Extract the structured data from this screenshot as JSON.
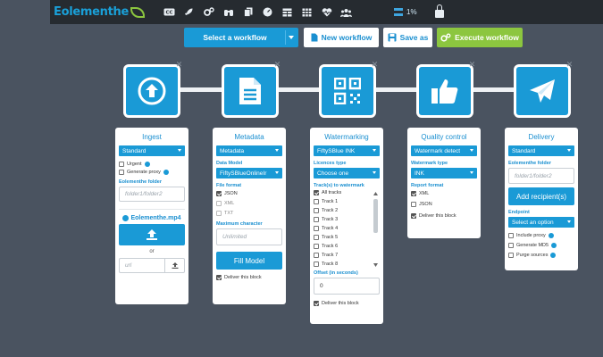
{
  "app": {
    "logo": "Eolementhe",
    "usage": "1%"
  },
  "nav_icons": [
    "cc-icon",
    "rocket-icon",
    "gears-icon",
    "binoculars-icon",
    "copy-icon",
    "gauge-icon",
    "table-icon",
    "grid-icon",
    "heartbeat-icon",
    "users-icon"
  ],
  "toolbar": {
    "select_workflow": "Select a workflow",
    "new_workflow": "New workflow",
    "save_as": "Save as",
    "execute": "Execute workflow"
  },
  "colors": {
    "accent": "#1a9ad6",
    "green": "#8cc63f",
    "background": "#4a5360",
    "topbar": "#262b30"
  },
  "blocks": {
    "ingest": {
      "title": "Ingest",
      "select": "Standard",
      "urgent": "Urgent",
      "generate_proxy": "Generate proxy",
      "folder_label": "Eolementhe folder",
      "folder_placeholder": "folder1/folder2",
      "file": "Eolementhe.mp4",
      "or": "or",
      "url_placeholder": "url"
    },
    "metadata": {
      "title": "Metadata",
      "select": "Metadata",
      "data_model_label": "Data Model",
      "data_model": "FiftySBlueOnlineIr",
      "file_format_label": "File format",
      "formats": [
        "JSON",
        "XML",
        "TXT"
      ],
      "max_char_label": "Maximum character",
      "max_char_placeholder": "Unlimited",
      "fill_model": "Fill Model",
      "deliver": "Deliver this block"
    },
    "watermarking": {
      "title": "Watermarking",
      "select": "FiftySBlue INK",
      "licences_label": "Licences type",
      "licences": "Choose one",
      "tracks_label": "Track(s) to watermark",
      "tracks": [
        "All tracks",
        "Track 1",
        "Track 2",
        "Track 3",
        "Track 4",
        "Track 5",
        "Track 6",
        "Track 7",
        "Track 8"
      ],
      "offset_label": "Offset (in seconds)",
      "offset_value": "0",
      "deliver": "Deliver this block"
    },
    "quality": {
      "title": "Quality control",
      "select": "Watermark detect",
      "wm_type_label": "Watermark type",
      "wm_type": "INK",
      "report_label": "Report format",
      "formats": [
        "XML",
        "JSON"
      ],
      "deliver": "Deliver this block"
    },
    "delivery": {
      "title": "Delivery",
      "select": "Standard",
      "folder_label": "Eolementhe folder",
      "folder_placeholder": "folder1/folder2",
      "add_recipients": "Add recipient(s)",
      "endpoint_label": "Endpoint",
      "endpoint": "Select an option",
      "include_proxy": "Include proxy",
      "generate_md5": "Generate MD5",
      "purge": "Purge sources"
    }
  }
}
